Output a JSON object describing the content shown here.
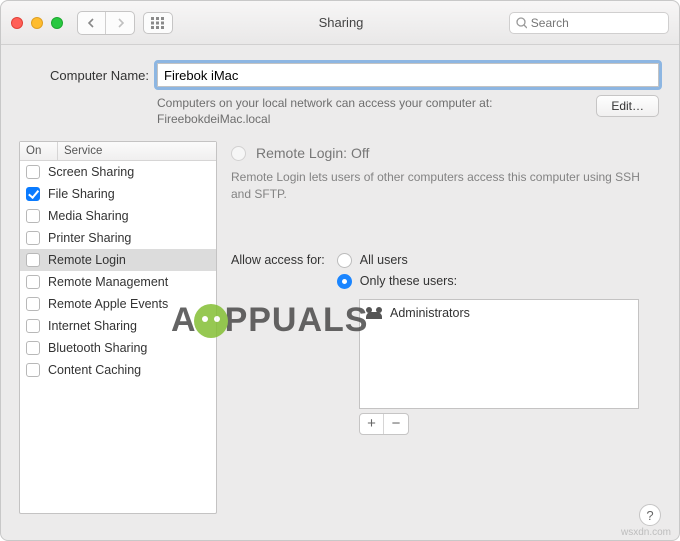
{
  "window": {
    "title": "Sharing"
  },
  "search": {
    "placeholder": "Search"
  },
  "computer": {
    "label": "Computer Name:",
    "value": "Firebok iMac",
    "desc1": "Computers on your local network can access your computer at:",
    "desc2": "FireebokdeiMac.local",
    "edit": "Edit…"
  },
  "services": {
    "hdr_on": "On",
    "hdr_service": "Service",
    "items": [
      {
        "label": "Screen Sharing",
        "on": false,
        "selected": false
      },
      {
        "label": "File Sharing",
        "on": true,
        "selected": false
      },
      {
        "label": "Media Sharing",
        "on": false,
        "selected": false
      },
      {
        "label": "Printer Sharing",
        "on": false,
        "selected": false
      },
      {
        "label": "Remote Login",
        "on": false,
        "selected": true
      },
      {
        "label": "Remote Management",
        "on": false,
        "selected": false
      },
      {
        "label": "Remote Apple Events",
        "on": false,
        "selected": false
      },
      {
        "label": "Internet Sharing",
        "on": false,
        "selected": false
      },
      {
        "label": "Bluetooth Sharing",
        "on": false,
        "selected": false
      },
      {
        "label": "Content Caching",
        "on": false,
        "selected": false
      }
    ]
  },
  "detail": {
    "title": "Remote Login: Off",
    "subtitle": "Remote Login lets users of other computers access this computer using SSH and SFTP.",
    "access_label": "Allow access for:",
    "opt_all": "All users",
    "opt_only": "Only these users:",
    "selected": "only",
    "users": [
      {
        "name": "Administrators"
      }
    ],
    "plus": "+",
    "minus": "−"
  },
  "help": "?",
  "watermark_site": "wsxdn.com",
  "watermark_brand": "PPUALS"
}
